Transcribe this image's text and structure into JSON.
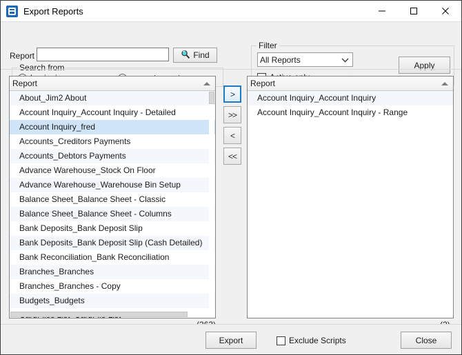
{
  "window": {
    "title": "Export Reports",
    "icon": "app-icon",
    "controls": {
      "minimize": "minimize-icon",
      "maximize": "maximize-icon",
      "close": "close-icon"
    }
  },
  "search": {
    "report_label": "Report",
    "report_value": "",
    "report_placeholder": "",
    "find_label": "Find",
    "find_icon": "magnifier-icon",
    "group_title": "Search from",
    "options": [
      {
        "label": "beginning",
        "checked": true
      },
      {
        "label": "current report",
        "checked": false
      }
    ]
  },
  "filter": {
    "group_title": "Filter",
    "select_value": "All Reports",
    "select_chevron": "chevron-down-icon",
    "active_only_label": "Active only",
    "active_only_checked": false,
    "apply_label": "Apply"
  },
  "left_panel": {
    "header": "Report",
    "sort_icon": "sort-ascending-icon",
    "count": "(363)",
    "rows": [
      "About_Jim2 About",
      "Account Inquiry_Account Inquiry - Detailed",
      "Account Inquiry_fred",
      "Accounts_Creditors Payments",
      "Accounts_Debtors Payments",
      "Advance Warehouse_Stock On Floor",
      "Advance Warehouse_Warehouse Bin Setup",
      "Balance Sheet_Balance Sheet - Classic",
      "Balance Sheet_Balance Sheet - Columns",
      "Bank Deposits_Bank Deposit Slip",
      "Bank Deposits_Bank Deposit Slip (Cash Detailed)",
      "Bank Reconciliation_Bank Reconciliation",
      "Branches_Branches",
      "Branches_Branches - Copy",
      "Budgets_Budgets",
      "CardFiles List_CardFile List"
    ],
    "selected_index": 2
  },
  "transfer_buttons": [
    {
      "label": ">",
      "name": "move-right-button",
      "focused": true
    },
    {
      "label": ">>",
      "name": "move-all-right-button",
      "focused": false
    },
    {
      "label": "<",
      "name": "move-left-button",
      "focused": false
    },
    {
      "label": "<<",
      "name": "move-all-left-button",
      "focused": false
    }
  ],
  "right_panel": {
    "header": "Report",
    "sort_icon": "sort-ascending-icon",
    "count": "(2)",
    "rows": [
      "Account Inquiry_Account Inquiry",
      "Account Inquiry_Account Inquiry - Range"
    ]
  },
  "footer": {
    "export_label": "Export",
    "exclude_scripts_label": "Exclude Scripts",
    "exclude_scripts_checked": false,
    "close_label": "Close"
  }
}
